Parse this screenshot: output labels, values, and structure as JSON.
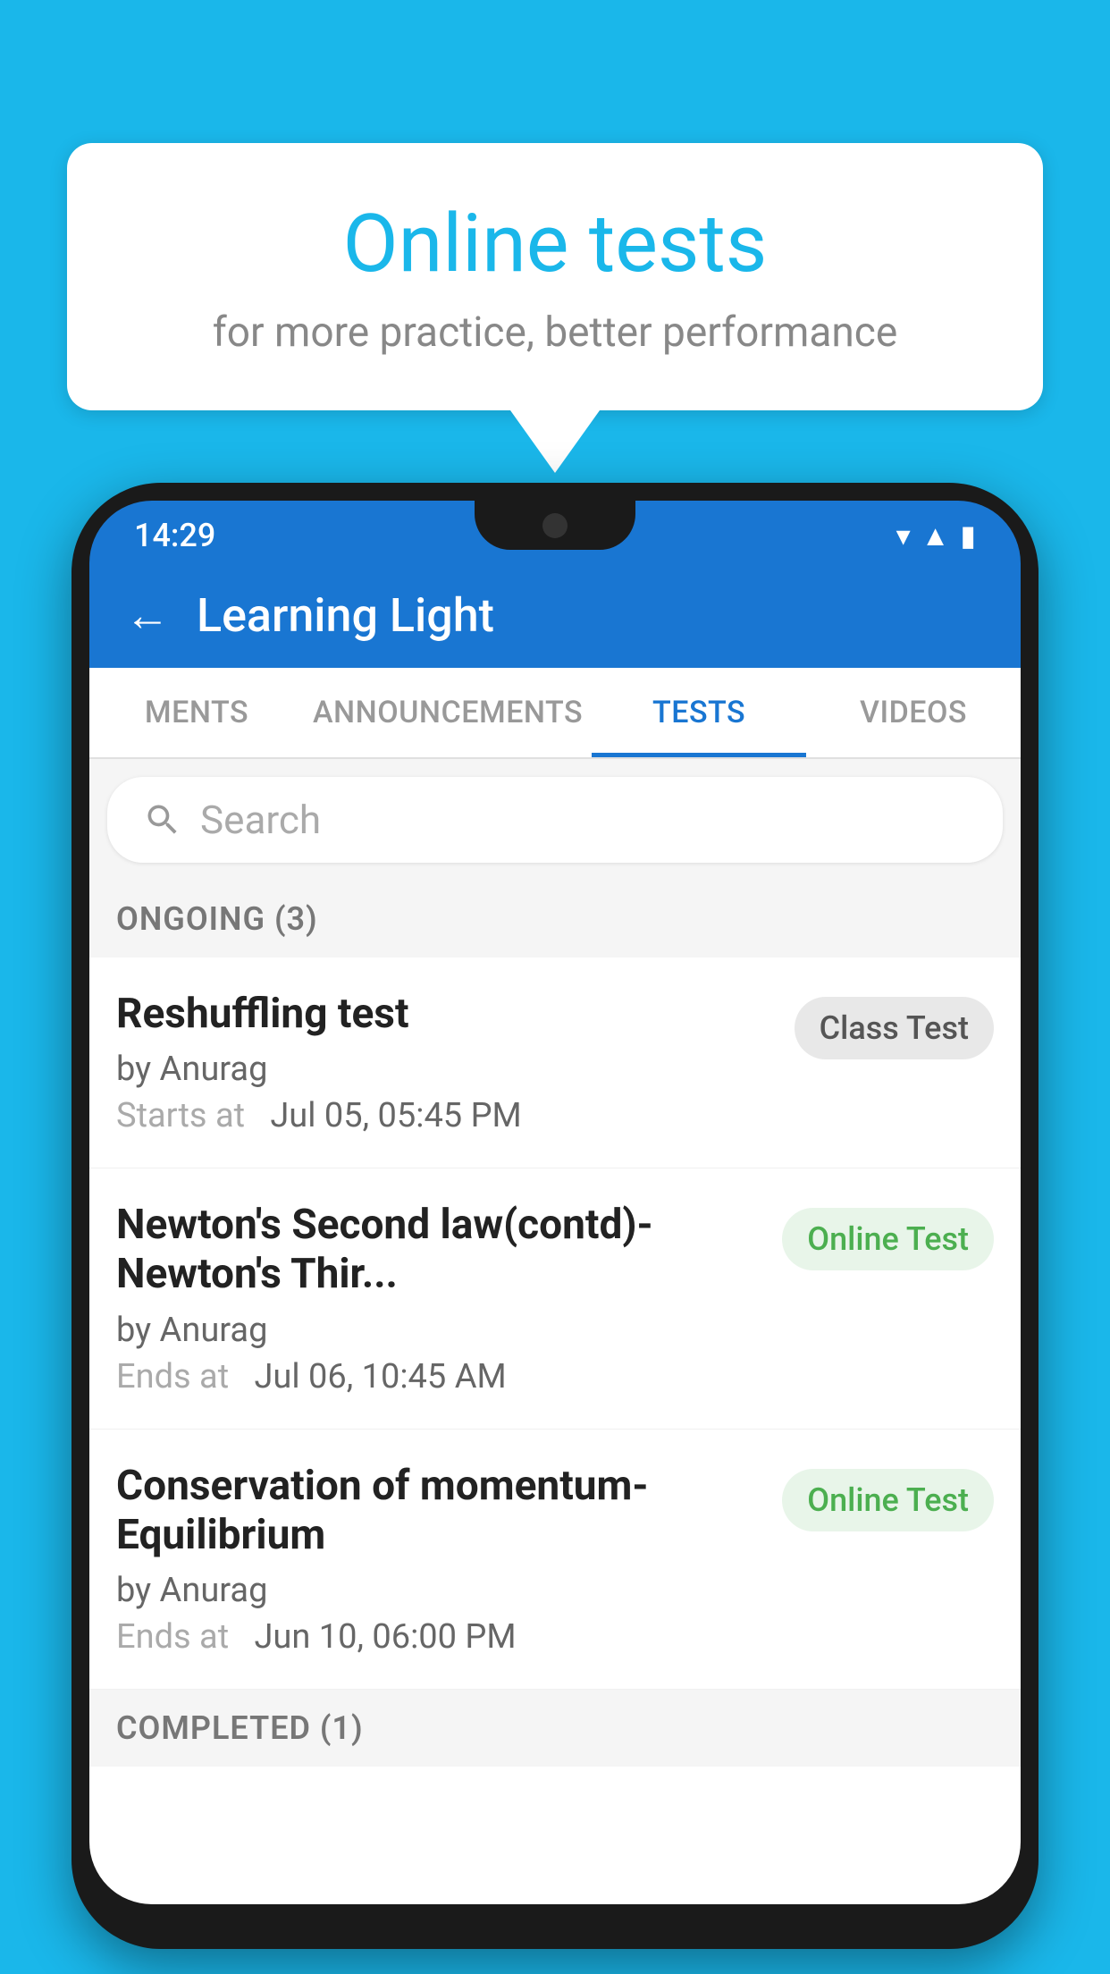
{
  "background_color": "#1ab7ea",
  "bubble": {
    "title": "Online tests",
    "subtitle": "for more practice, better performance"
  },
  "phone": {
    "time": "14:29",
    "app_bar": {
      "title": "Learning Light",
      "back_label": "←"
    },
    "tabs": [
      {
        "label": "MENTS",
        "active": false
      },
      {
        "label": "ANNOUNCEMENTS",
        "active": false
      },
      {
        "label": "TESTS",
        "active": true
      },
      {
        "label": "VIDEOS",
        "active": false
      }
    ],
    "search": {
      "placeholder": "Search"
    },
    "ongoing_section": {
      "label": "ONGOING (3)"
    },
    "tests": [
      {
        "title": "Reshuffling test",
        "author": "by Anurag",
        "time_label": "Starts at",
        "time_value": "Jul 05, 05:45 PM",
        "badge": "Class Test",
        "badge_type": "class"
      },
      {
        "title": "Newton's Second law(contd)-Newton's Thir...",
        "author": "by Anurag",
        "time_label": "Ends at",
        "time_value": "Jul 06, 10:45 AM",
        "badge": "Online Test",
        "badge_type": "online"
      },
      {
        "title": "Conservation of momentum-Equilibrium",
        "author": "by Anurag",
        "time_label": "Ends at",
        "time_value": "Jun 10, 06:00 PM",
        "badge": "Online Test",
        "badge_type": "online"
      }
    ],
    "completed_section": {
      "label": "COMPLETED (1)"
    }
  }
}
